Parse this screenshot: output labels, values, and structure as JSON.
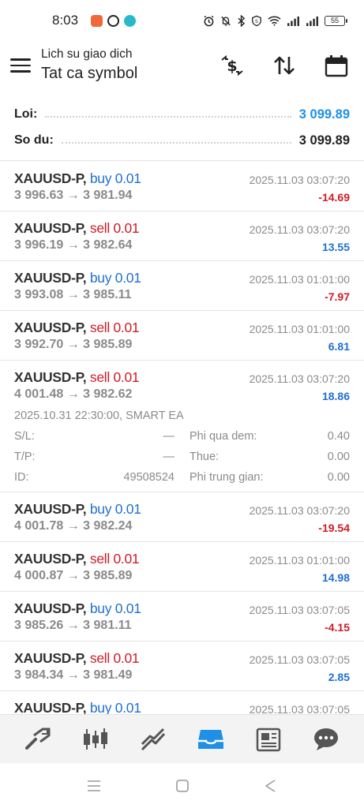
{
  "status": {
    "time": "8:03",
    "battery": "55"
  },
  "header": {
    "subtitle": "Lich su giao dich",
    "title": "Tat ca symbol"
  },
  "summary": {
    "profit_label": "Loi:",
    "profit_value": "3 099.89",
    "balance_label": "So du:",
    "balance_value": "3 099.89"
  },
  "trades": [
    {
      "symbol": "XAUUSD-P,",
      "direction": "buy",
      "volume": "0.01",
      "time": "2025.11.03 03:07:20",
      "prices": "3 996.63 → 3 981.94",
      "pnl": "-14.69"
    },
    {
      "symbol": "XAUUSD-P,",
      "direction": "sell",
      "volume": "0.01",
      "time": "2025.11.03 03:07:20",
      "prices": "3 996.19 → 3 982.64",
      "pnl": "13.55"
    },
    {
      "symbol": "XAUUSD-P,",
      "direction": "buy",
      "volume": "0.01",
      "time": "2025.11.03 01:01:00",
      "prices": "3 993.08 → 3 985.11",
      "pnl": "-7.97"
    },
    {
      "symbol": "XAUUSD-P,",
      "direction": "sell",
      "volume": "0.01",
      "time": "2025.11.03 01:01:00",
      "prices": "3 992.70 → 3 985.89",
      "pnl": "6.81"
    },
    {
      "symbol": "XAUUSD-P,",
      "direction": "sell",
      "volume": "0.01",
      "time": "2025.11.03 03:07:20",
      "prices": "4 001.48 → 3 982.62",
      "pnl": "18.86",
      "details": {
        "open_info": "2025.10.31 22:30:00, SMART EA",
        "sl_label": "S/L:",
        "sl_value": "—",
        "tp_label": "T/P:",
        "tp_value": "—",
        "id_label": "ID:",
        "id_value": "49508524",
        "swap_label": "Phi qua dem:",
        "swap_value": "0.40",
        "tax_label": "Thue:",
        "tax_value": "0.00",
        "commission_label": "Phi trung gian:",
        "commission_value": "0.00"
      }
    },
    {
      "symbol": "XAUUSD-P,",
      "direction": "buy",
      "volume": "0.01",
      "time": "2025.11.03 03:07:20",
      "prices": "4 001.78 → 3 982.24",
      "pnl": "-19.54"
    },
    {
      "symbol": "XAUUSD-P,",
      "direction": "sell",
      "volume": "0.01",
      "time": "2025.11.03 01:01:00",
      "prices": "4 000.87 → 3 985.89",
      "pnl": "14.98"
    },
    {
      "symbol": "XAUUSD-P,",
      "direction": "buy",
      "volume": "0.01",
      "time": "2025.11.03 03:07:05",
      "prices": "3 985.26 → 3 981.11",
      "pnl": "-4.15"
    },
    {
      "symbol": "XAUUSD-P,",
      "direction": "sell",
      "volume": "0.01",
      "time": "2025.11.03 03:07:05",
      "prices": "3 984.34 → 3 981.49",
      "pnl": "2.85"
    },
    {
      "symbol": "XAUUSD-P,",
      "direction": "buy",
      "volume": "0.01",
      "time": "2025.11.03 03:07:05",
      "prices": "",
      "pnl": ""
    }
  ],
  "colors": {
    "buy": "#1f6fd1",
    "sell": "#d01b24",
    "accent": "#1f8fe8"
  },
  "bottom_nav": [
    "quotes-icon",
    "chart-icon",
    "trade-icon",
    "history-icon",
    "news-icon",
    "messages-icon"
  ],
  "bottom_nav_active": "history-icon"
}
